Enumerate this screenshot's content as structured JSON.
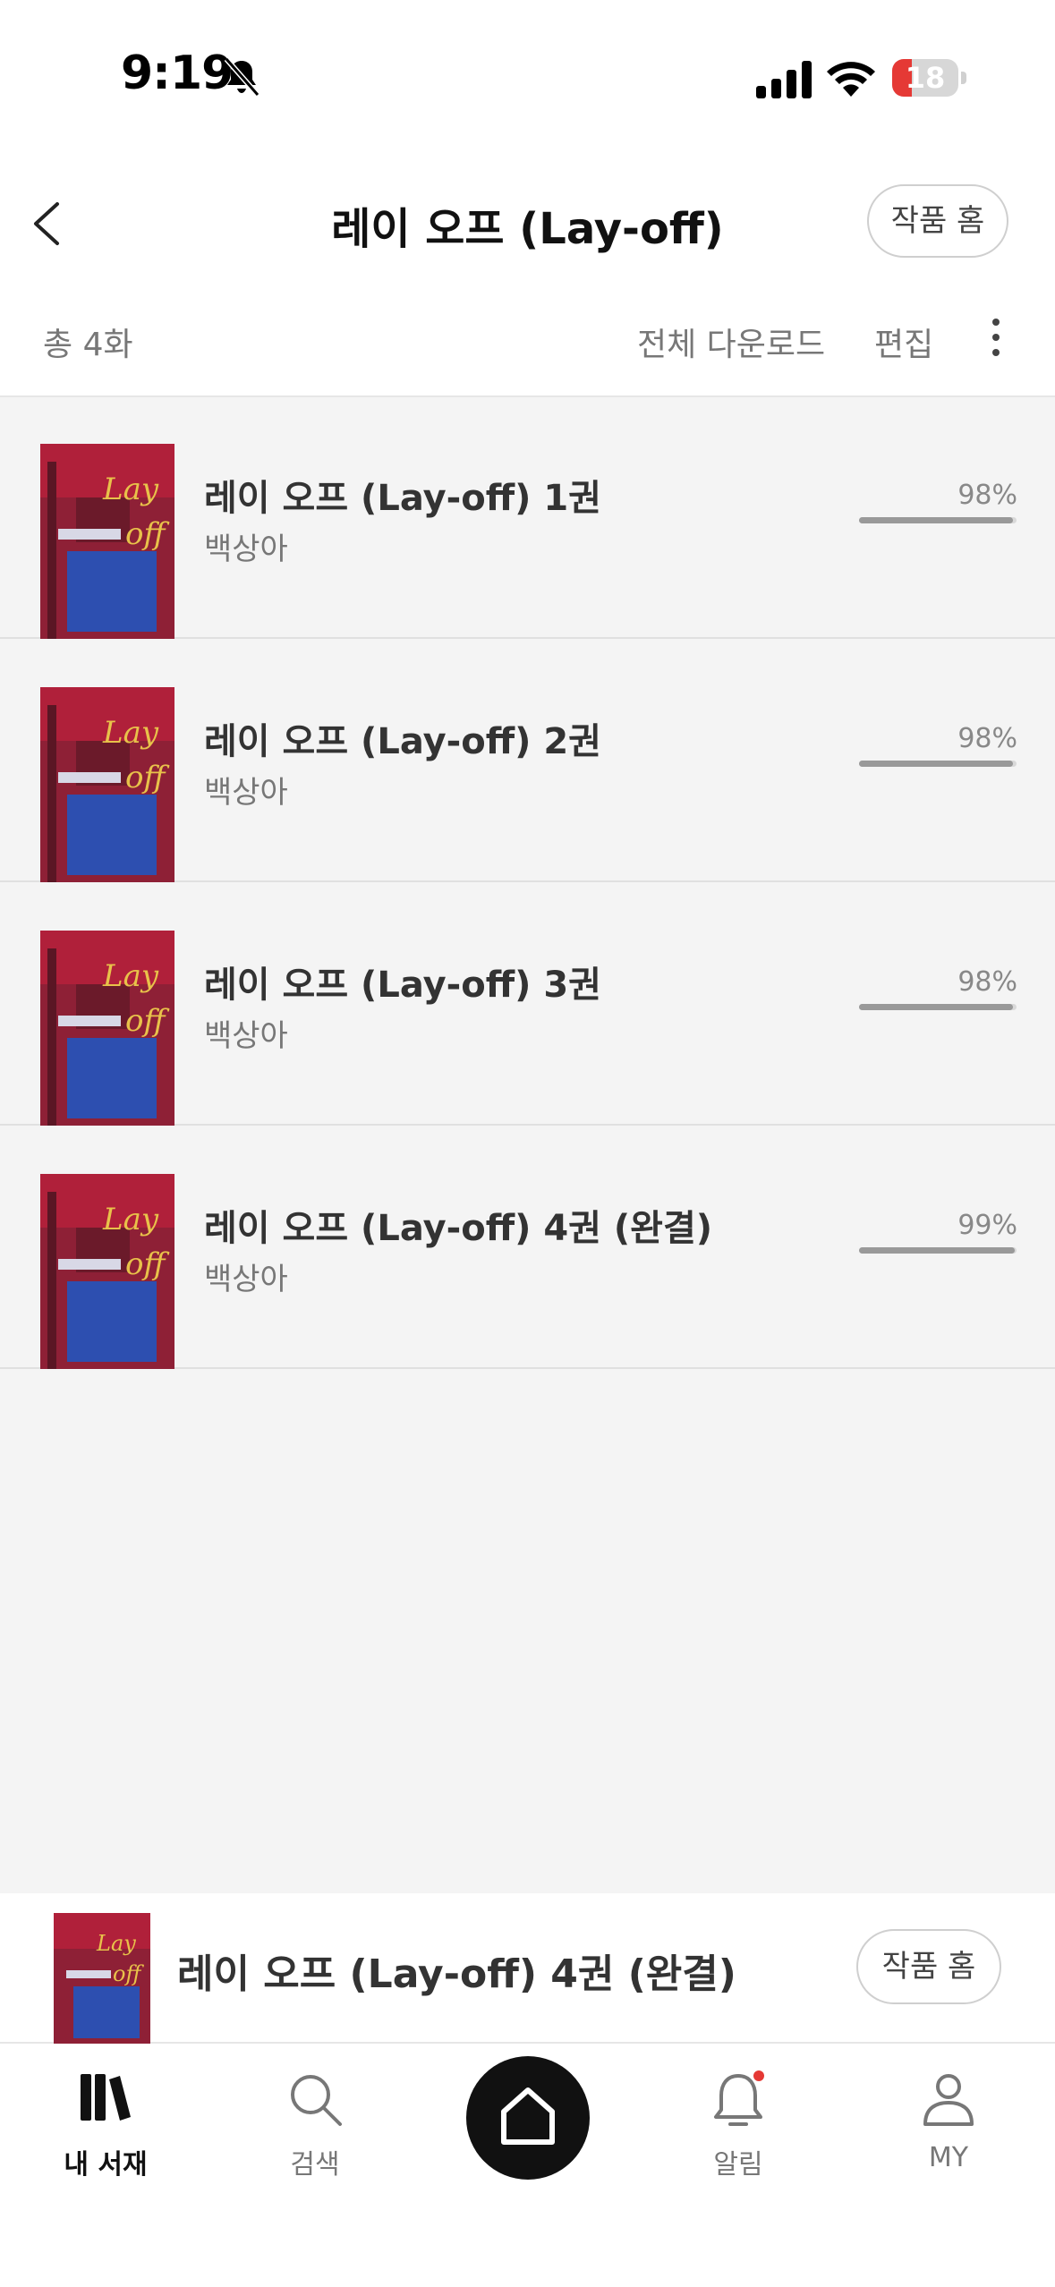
{
  "status_bar": {
    "time": "9:19",
    "battery": "18"
  },
  "header": {
    "title": "레이 오프 (Lay-off)",
    "home_button": "작품 홈",
    "count": "총 4화",
    "download_all": "전체 다운로드",
    "edit": "편집"
  },
  "volumes": [
    {
      "title": "레이 오프 (Lay-off) 1권",
      "author": "백상아",
      "progress_label": "98%",
      "progress": 0.98
    },
    {
      "title": "레이 오프 (Lay-off) 2권",
      "author": "백상아",
      "progress_label": "98%",
      "progress": 0.98
    },
    {
      "title": "레이 오프 (Lay-off) 3권",
      "author": "백상아",
      "progress_label": "98%",
      "progress": 0.98
    },
    {
      "title": "레이 오프 (Lay-off) 4권 (완결)",
      "author": "백상아",
      "progress_label": "99%",
      "progress": 0.99
    }
  ],
  "mini_player": {
    "title": "레이 오프 (Lay-off) 4권 (완결)",
    "home_button": "작품 홈"
  },
  "tabbar": {
    "library": "내 서재",
    "search": "검색",
    "notifications": "알림",
    "my": "MY"
  },
  "colors": {
    "accent": "#111111",
    "badge": "#e53935",
    "cover_red": "#b0203a",
    "cover_blue": "#2d4fb0"
  }
}
